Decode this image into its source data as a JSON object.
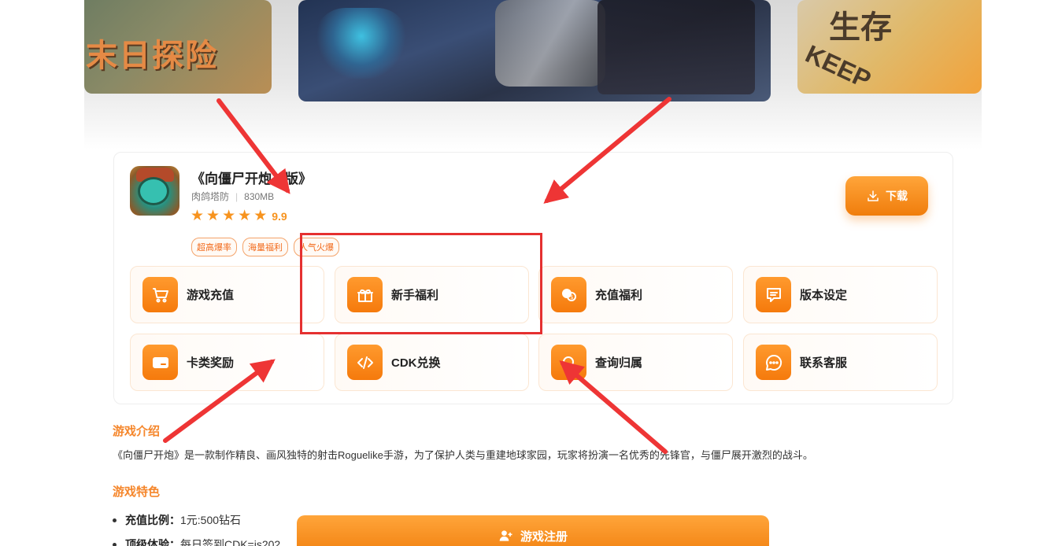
{
  "banner": {
    "left_slide_text": "末日探险",
    "right_slide_text": "生存",
    "right_slide_subtext": "KEEP"
  },
  "game": {
    "name": "《向僵尸开炮…版》",
    "category": "肉鸽塔防",
    "size": "830MB",
    "rating": "9.9",
    "stars": 5,
    "tags": [
      "超高爆率",
      "海量福利",
      "人气火爆"
    ]
  },
  "download_button": {
    "label": "下载"
  },
  "features": [
    {
      "label": "游戏充值",
      "icon": "cart-icon"
    },
    {
      "label": "新手福利",
      "icon": "gift-icon"
    },
    {
      "label": "充值福利",
      "icon": "coins-icon"
    },
    {
      "label": "版本设定",
      "icon": "message-list-icon"
    },
    {
      "label": "卡类奖励",
      "icon": "card-icon"
    },
    {
      "label": "CDK兑换",
      "icon": "code-icon"
    },
    {
      "label": "查询归属",
      "icon": "search-icon"
    },
    {
      "label": "联系客服",
      "icon": "chat-icon"
    }
  ],
  "intro": {
    "title": "游戏介绍",
    "text": "《向僵尸开炮》是一款制作精良、画风独特的射击Roguelike手游，为了保护人类与重建地球家园，玩家将扮演一名优秀的先锋官，与僵尸展开激烈的战斗。"
  },
  "features_section": {
    "title": "游戏特色",
    "items": [
      {
        "key": "充值比例：",
        "value": "1元:500钻石"
      },
      {
        "key": "顶级体验：",
        "value": "每日签到CDK=js202"
      }
    ]
  },
  "register_button": {
    "label": "游戏注册"
  },
  "colors": {
    "accent": "#f5862b",
    "annotation": "#e53030"
  }
}
